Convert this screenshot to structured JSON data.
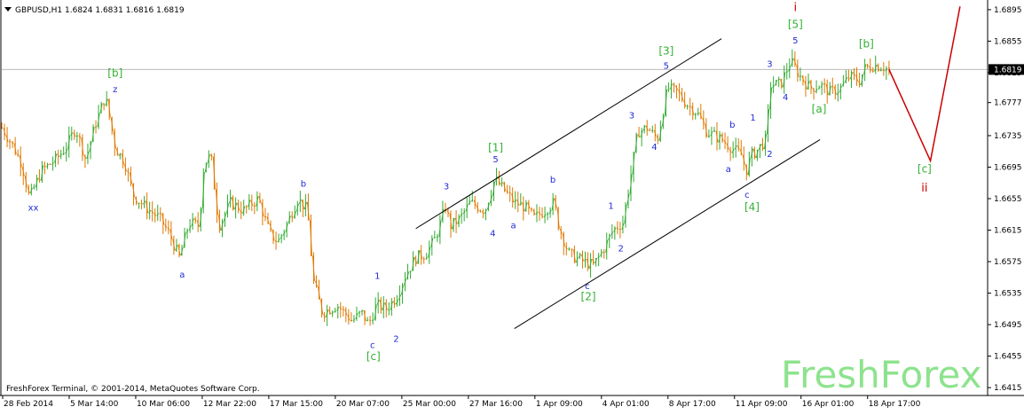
{
  "header": {
    "symbol_info": "GBPUSD,H1  1.6824 1.6831 1.6816 1.6819"
  },
  "footer": {
    "copyright": "FreshForex Terminal, © 2001-2014, MetaQuotes Software Corp."
  },
  "brand": {
    "watermark": "FreshForex"
  },
  "colors": {
    "bull": "#33aa33",
    "bear": "#e07800",
    "wave_small": "#1f2bd6",
    "wave_bracket": "#33b233",
    "wave_red": "#cc0000",
    "channel": "#000000",
    "grid_price_line": "#bbbbbb",
    "watermark": "#8de38d"
  },
  "chart_data": {
    "type": "candlestick",
    "symbol": "GBPUSD",
    "timeframe": "H1",
    "ohlc_last": {
      "open": 1.6824,
      "high": 1.6831,
      "low": 1.6816,
      "close": 1.6819
    },
    "ylim": [
      1.6405,
      1.6905
    ],
    "y_ticks": [
      "1.6895",
      "1.6855",
      "1.6815",
      "1.6777",
      "1.6735",
      "1.6695",
      "1.6655",
      "1.6615",
      "1.6575",
      "1.6535",
      "1.6495",
      "1.6455",
      "1.6415"
    ],
    "current_price_label": "1.6819",
    "x_ticks": [
      "28 Feb 2014",
      "5 Mar 14:00",
      "10 Mar 06:00",
      "12 Mar 22:00",
      "17 Mar 15:00",
      "20 Mar 07:00",
      "25 Mar 00:00",
      "27 Mar 16:00",
      "1 Apr 09:00",
      "4 Apr 01:00",
      "8 Apr 17:00",
      "11 Apr 09:00",
      "16 Apr 01:00",
      "18 Apr 17:00"
    ],
    "price_path": [
      [
        0,
        1.6745
      ],
      [
        0.01,
        1.6725
      ],
      [
        0.02,
        1.67
      ],
      [
        0.028,
        1.6655
      ],
      [
        0.04,
        1.669
      ],
      [
        0.055,
        1.6705
      ],
      [
        0.065,
        1.672
      ],
      [
        0.075,
        1.6745
      ],
      [
        0.085,
        1.6705
      ],
      [
        0.095,
        1.675
      ],
      [
        0.105,
        1.6785
      ],
      [
        0.115,
        1.672
      ],
      [
        0.125,
        1.67
      ],
      [
        0.133,
        1.666
      ],
      [
        0.145,
        1.6645
      ],
      [
        0.16,
        1.663
      ],
      [
        0.17,
        1.661
      ],
      [
        0.18,
        1.658
      ],
      [
        0.19,
        1.6625
      ],
      [
        0.2,
        1.662
      ],
      [
        0.205,
        1.67
      ],
      [
        0.212,
        1.671
      ],
      [
        0.22,
        1.662
      ],
      [
        0.232,
        1.665
      ],
      [
        0.245,
        1.664
      ],
      [
        0.26,
        1.6655
      ],
      [
        0.272,
        1.661
      ],
      [
        0.28,
        1.66
      ],
      [
        0.29,
        1.6625
      ],
      [
        0.3,
        1.6655
      ],
      [
        0.31,
        1.664
      ],
      [
        0.316,
        1.655
      ],
      [
        0.325,
        1.651
      ],
      [
        0.34,
        1.652
      ],
      [
        0.355,
        1.65
      ],
      [
        0.365,
        1.651
      ],
      [
        0.372,
        1.6495
      ],
      [
        0.38,
        1.652
      ],
      [
        0.39,
        1.6515
      ],
      [
        0.4,
        1.653
      ],
      [
        0.41,
        1.656
      ],
      [
        0.42,
        1.658
      ],
      [
        0.43,
        1.6585
      ],
      [
        0.44,
        1.6605
      ],
      [
        0.45,
        1.6645
      ],
      [
        0.455,
        1.662
      ],
      [
        0.465,
        1.663
      ],
      [
        0.475,
        1.665
      ],
      [
        0.49,
        1.664
      ],
      [
        0.5,
        1.668
      ],
      [
        0.51,
        1.6665
      ],
      [
        0.52,
        1.665
      ],
      [
        0.53,
        1.6645
      ],
      [
        0.54,
        1.663
      ],
      [
        0.55,
        1.664
      ],
      [
        0.56,
        1.665
      ],
      [
        0.565,
        1.662
      ],
      [
        0.575,
        1.6585
      ],
      [
        0.59,
        1.6575
      ],
      [
        0.6,
        1.657
      ],
      [
        0.61,
        1.659
      ],
      [
        0.62,
        1.6615
      ],
      [
        0.63,
        1.6625
      ],
      [
        0.64,
        1.67
      ],
      [
        0.645,
        1.674
      ],
      [
        0.655,
        1.6745
      ],
      [
        0.665,
        1.673
      ],
      [
        0.675,
        1.6795
      ],
      [
        0.685,
        1.679
      ],
      [
        0.695,
        1.6775
      ],
      [
        0.705,
        1.6765
      ],
      [
        0.715,
        1.674
      ],
      [
        0.73,
        1.673
      ],
      [
        0.74,
        1.672
      ],
      [
        0.75,
        1.671
      ],
      [
        0.755,
        1.669
      ],
      [
        0.76,
        1.671
      ],
      [
        0.765,
        1.6715
      ],
      [
        0.775,
        1.673
      ],
      [
        0.78,
        1.68
      ],
      [
        0.79,
        1.68
      ],
      [
        0.8,
        1.683
      ],
      [
        0.81,
        1.681
      ],
      [
        0.82,
        1.6795
      ],
      [
        0.83,
        1.68
      ],
      [
        0.84,
        1.679
      ],
      [
        0.85,
        1.6795
      ],
      [
        0.86,
        1.681
      ],
      [
        0.87,
        1.6805
      ],
      [
        0.875,
        1.682
      ],
      [
        0.885,
        1.6825
      ],
      [
        0.895,
        1.6822
      ],
      [
        0.9,
        1.6819
      ]
    ],
    "projection_path": [
      [
        0.9,
        1.6819
      ],
      [
        0.942,
        1.6703
      ],
      [
        0.972,
        1.6899
      ]
    ],
    "channels": [
      {
        "name": "channel-upper",
        "from": [
          0.42,
          1.6617
        ],
        "to": [
          0.73,
          1.6858
        ]
      },
      {
        "name": "channel-lower",
        "from": [
          0.52,
          1.649
        ],
        "to": [
          0.83,
          1.673
        ]
      }
    ],
    "wave_labels": [
      {
        "text": "[b]",
        "x": 0.115,
        "y": 1.681,
        "style": "bracket"
      },
      {
        "text": "z",
        "x": 0.115,
        "y": 1.679,
        "style": "small"
      },
      {
        "text": "xx",
        "x": 0.032,
        "y": 1.664,
        "style": "small"
      },
      {
        "text": "a",
        "x": 0.183,
        "y": 1.6555,
        "style": "small"
      },
      {
        "text": "b",
        "x": 0.306,
        "y": 1.667,
        "style": "small"
      },
      {
        "text": "1",
        "x": 0.381,
        "y": 1.6553,
        "style": "small"
      },
      {
        "text": "2",
        "x": 0.4,
        "y": 1.6473,
        "style": "small"
      },
      {
        "text": "c",
        "x": 0.376,
        "y": 1.6465,
        "style": "small"
      },
      {
        "text": "[c]",
        "x": 0.377,
        "y": 1.645,
        "style": "bracket"
      },
      {
        "text": "3",
        "x": 0.451,
        "y": 1.6667,
        "style": "small"
      },
      {
        "text": "4",
        "x": 0.498,
        "y": 1.6607,
        "style": "small"
      },
      {
        "text": "5",
        "x": 0.501,
        "y": 1.6701,
        "style": "small"
      },
      {
        "text": "[1]",
        "x": 0.501,
        "y": 1.6715,
        "style": "bracket"
      },
      {
        "text": "a",
        "x": 0.519,
        "y": 1.6617,
        "style": "small"
      },
      {
        "text": "b",
        "x": 0.559,
        "y": 1.6675,
        "style": "small"
      },
      {
        "text": "c",
        "x": 0.594,
        "y": 1.654,
        "style": "small"
      },
      {
        "text": "[2]",
        "x": 0.595,
        "y": 1.6526,
        "style": "bracket"
      },
      {
        "text": "1",
        "x": 0.618,
        "y": 1.6642,
        "style": "small"
      },
      {
        "text": "2",
        "x": 0.628,
        "y": 1.6588,
        "style": "small"
      },
      {
        "text": "3",
        "x": 0.639,
        "y": 1.6757,
        "style": "small"
      },
      {
        "text": "4",
        "x": 0.662,
        "y": 1.6717,
        "style": "small"
      },
      {
        "text": "[3]",
        "x": 0.674,
        "y": 1.6838,
        "style": "bracket"
      },
      {
        "text": "5",
        "x": 0.674,
        "y": 1.682,
        "style": "small"
      },
      {
        "text": "a",
        "x": 0.737,
        "y": 1.6689,
        "style": "small"
      },
      {
        "text": "b",
        "x": 0.741,
        "y": 1.6745,
        "style": "small"
      },
      {
        "text": "c",
        "x": 0.756,
        "y": 1.6656,
        "style": "small"
      },
      {
        "text": "[4]",
        "x": 0.761,
        "y": 1.664,
        "style": "bracket"
      },
      {
        "text": "1",
        "x": 0.762,
        "y": 1.6754,
        "style": "small"
      },
      {
        "text": "2",
        "x": 0.779,
        "y": 1.6708,
        "style": "small"
      },
      {
        "text": "3",
        "x": 0.779,
        "y": 1.6822,
        "style": "small"
      },
      {
        "text": "4",
        "x": 0.795,
        "y": 1.678,
        "style": "small"
      },
      {
        "text": "i",
        "x": 0.805,
        "y": 1.6893,
        "style": "red"
      },
      {
        "text": "[5]",
        "x": 0.805,
        "y": 1.6872,
        "style": "bracket"
      },
      {
        "text": "5",
        "x": 0.805,
        "y": 1.6852,
        "style": "small"
      },
      {
        "text": "[a]",
        "x": 0.829,
        "y": 1.6764,
        "style": "bracket"
      },
      {
        "text": "[b]",
        "x": 0.877,
        "y": 1.6847,
        "style": "bracket"
      },
      {
        "text": "[c]",
        "x": 0.936,
        "y": 1.6688,
        "style": "bracket"
      },
      {
        "text": "ii",
        "x": 0.936,
        "y": 1.6664,
        "style": "red"
      }
    ]
  }
}
